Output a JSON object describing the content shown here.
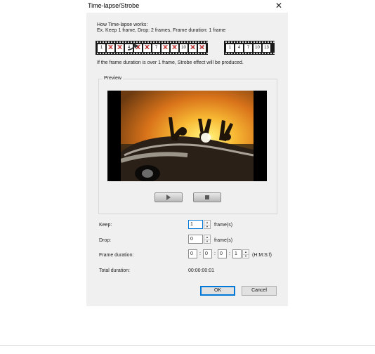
{
  "dialog": {
    "title": "Time-lapse/Strobe",
    "close_glyph": "✕"
  },
  "intro": {
    "line1": "How Time-lapse works:",
    "line2": "Ex. Keep 1 frame, Drop: 2 frames, Frame duration: 1 frame",
    "source_frames": [
      {
        "label": "1",
        "dropped": false
      },
      {
        "label": "2",
        "dropped": true
      },
      {
        "label": "3",
        "dropped": true
      },
      {
        "label": "4",
        "dropped": false
      },
      {
        "label": "5",
        "dropped": true
      },
      {
        "label": "6",
        "dropped": true
      },
      {
        "label": "7",
        "dropped": false
      },
      {
        "label": "8",
        "dropped": true
      },
      {
        "label": "9",
        "dropped": true
      },
      {
        "label": "10",
        "dropped": false
      },
      {
        "label": "11",
        "dropped": true
      },
      {
        "label": "12",
        "dropped": true
      }
    ],
    "result_frames": [
      "1",
      "4",
      "7",
      "10",
      "13"
    ],
    "arrow_icon": "arrow-right-icon",
    "note": "If the frame duration is over 1 frame, Strobe effect will be produced."
  },
  "preview": {
    "label": "Preview",
    "play_icon": "play-icon",
    "stop_icon": "stop-icon"
  },
  "form": {
    "keep_label": "Keep:",
    "keep_value": "1",
    "keep_unit": "frame(s)",
    "drop_label": "Drop:",
    "drop_value": "0",
    "drop_unit": "frame(s)",
    "duration_label": "Frame duration:",
    "duration_h": "0",
    "duration_m": "0",
    "duration_s": "0",
    "duration_f": "1",
    "duration_sep": ":",
    "duration_format": "(H:M:S:f)",
    "total_label": "Total duration:",
    "total_value": "00:00:00:01"
  },
  "buttons": {
    "ok": "OK",
    "cancel": "Cancel"
  },
  "colors": {
    "dialog_bg": "#f0f0f0",
    "accent": "#0078d7",
    "drop_mark": "#d02020"
  }
}
